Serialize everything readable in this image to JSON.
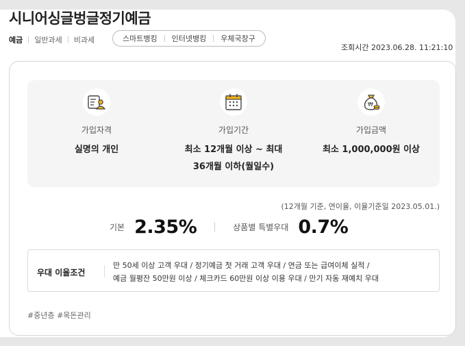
{
  "header": {
    "title": "시니어싱글벙글정기예금",
    "categories": [
      "예금",
      "일반과세",
      "비과세"
    ],
    "channels": [
      "스마트뱅킹",
      "인터넷뱅킹",
      "우체국창구"
    ],
    "inquiry_time": "조회시간 2023.06.28. 11:21:10"
  },
  "info": {
    "eligibility": {
      "label": "가입자격",
      "value": "실명의 개인",
      "icon": "person-document-icon"
    },
    "period": {
      "label": "가입기간",
      "value_line1": "최소 12개월 이상 ~ 최대",
      "value_line2": "36개월 이하(월일수)",
      "icon": "calendar-icon"
    },
    "amount": {
      "label": "가입금액",
      "value": "최소 1,000,000원 이상",
      "icon": "money-bag-icon"
    }
  },
  "rates": {
    "basis_note": "(12개월 기준, 연이율, 이율기준일 2023.05.01.)",
    "base_label": "기본",
    "base_value": "2.35%",
    "special_label": "상품별 특별우대",
    "special_value": "0.7%"
  },
  "preferential": {
    "title": "우대 이율조건",
    "line1": "만 50세 이상 고객 우대  /  정기예금 첫 거래 고객 우대  /  연금 또는 급여이체 실적  /",
    "line2": "예금 월평잔 50만원 이상  /  체크카드 60만원 이상 이용 우대  /  만기 자동 재예치 우대"
  },
  "tags": "#중년층 #목돈관리",
  "colors": {
    "accent": "#f2b21b",
    "panel": "#f5f5f5",
    "border": "#d6d6d6"
  }
}
